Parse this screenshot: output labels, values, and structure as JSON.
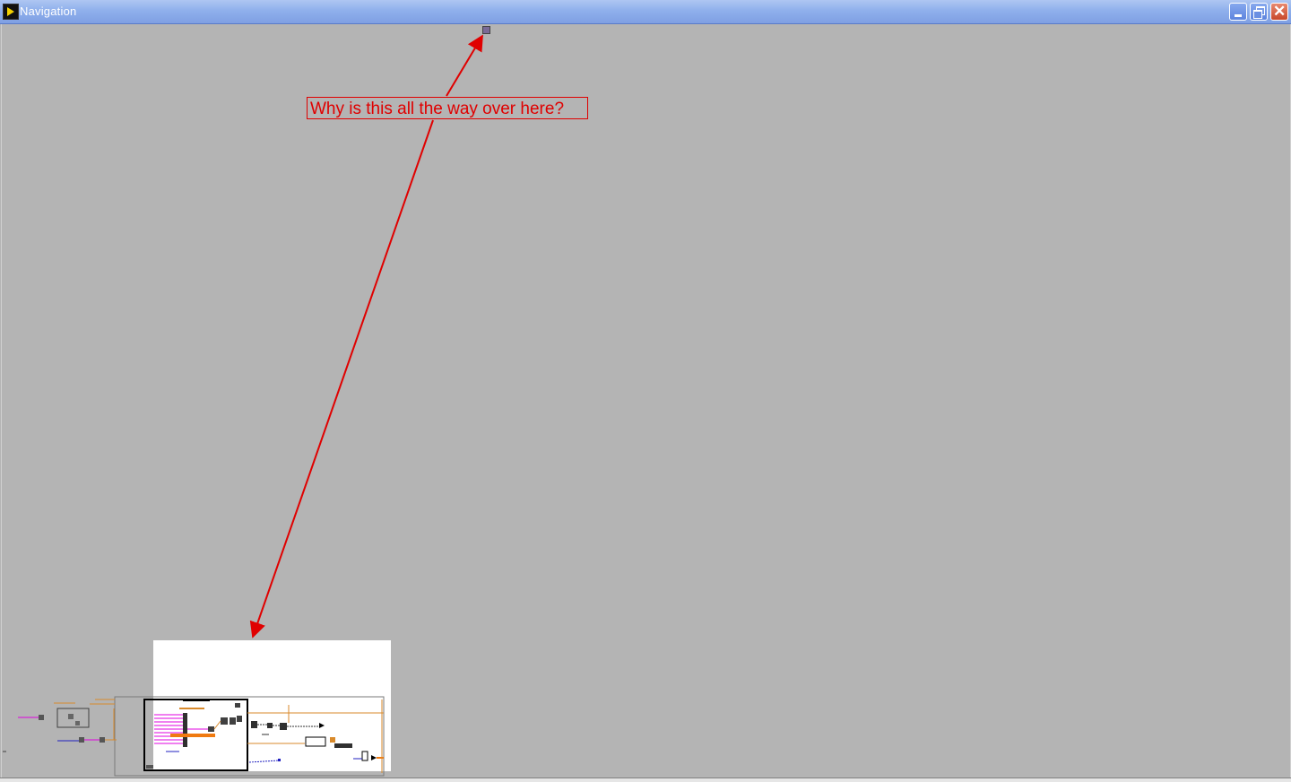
{
  "window": {
    "title": "Navigation",
    "controls": [
      "minimize",
      "restore",
      "close"
    ]
  },
  "annotation": {
    "text": "Why is this all the way over here?",
    "color": "#e00000"
  },
  "colors": {
    "canvas": "#b4b4b4",
    "titlebar": "#8fb0ec",
    "wire_orange": "#d98a2b",
    "wire_pink": "#e000e0",
    "wire_blue": "#2020c0"
  },
  "icons": {
    "app": "labview-icon",
    "stray_node": "vi-node-icon"
  }
}
